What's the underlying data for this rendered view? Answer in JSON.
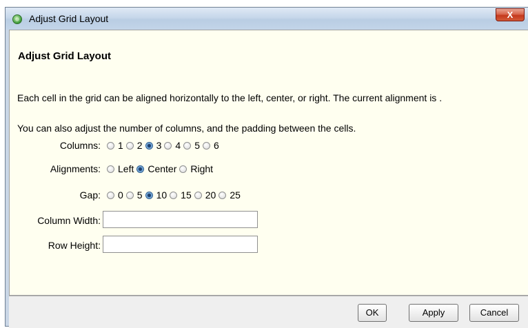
{
  "window": {
    "title": "Adjust Grid Layout",
    "close_label": "X"
  },
  "dialog": {
    "heading": "Adjust Grid Layout",
    "description_1": "Each cell in the grid can be aligned horizontally to the left, center, or right. The current alignment is .",
    "description_2": "You can also adjust the number of columns, and the padding between the cells."
  },
  "columns": {
    "label": "Columns:",
    "options": [
      "1",
      "2",
      "3",
      "4",
      "5",
      "6"
    ],
    "selected": "3"
  },
  "alignments": {
    "label": "Alignments:",
    "options": [
      "Left",
      "Center",
      "Right"
    ],
    "selected": "Center"
  },
  "gap": {
    "label": "Gap:",
    "options": [
      "0",
      "5",
      "10",
      "15",
      "20",
      "25"
    ],
    "selected": "10"
  },
  "column_width": {
    "label": "Column Width:",
    "value": ""
  },
  "row_height": {
    "label": "Row Height:",
    "value": ""
  },
  "buttons": {
    "ok": "OK",
    "apply": "Apply",
    "cancel": "Cancel"
  },
  "colors": {
    "content_background": "#fffff0",
    "titlebar": "#c6d7ea",
    "close_button": "#c4391d"
  }
}
